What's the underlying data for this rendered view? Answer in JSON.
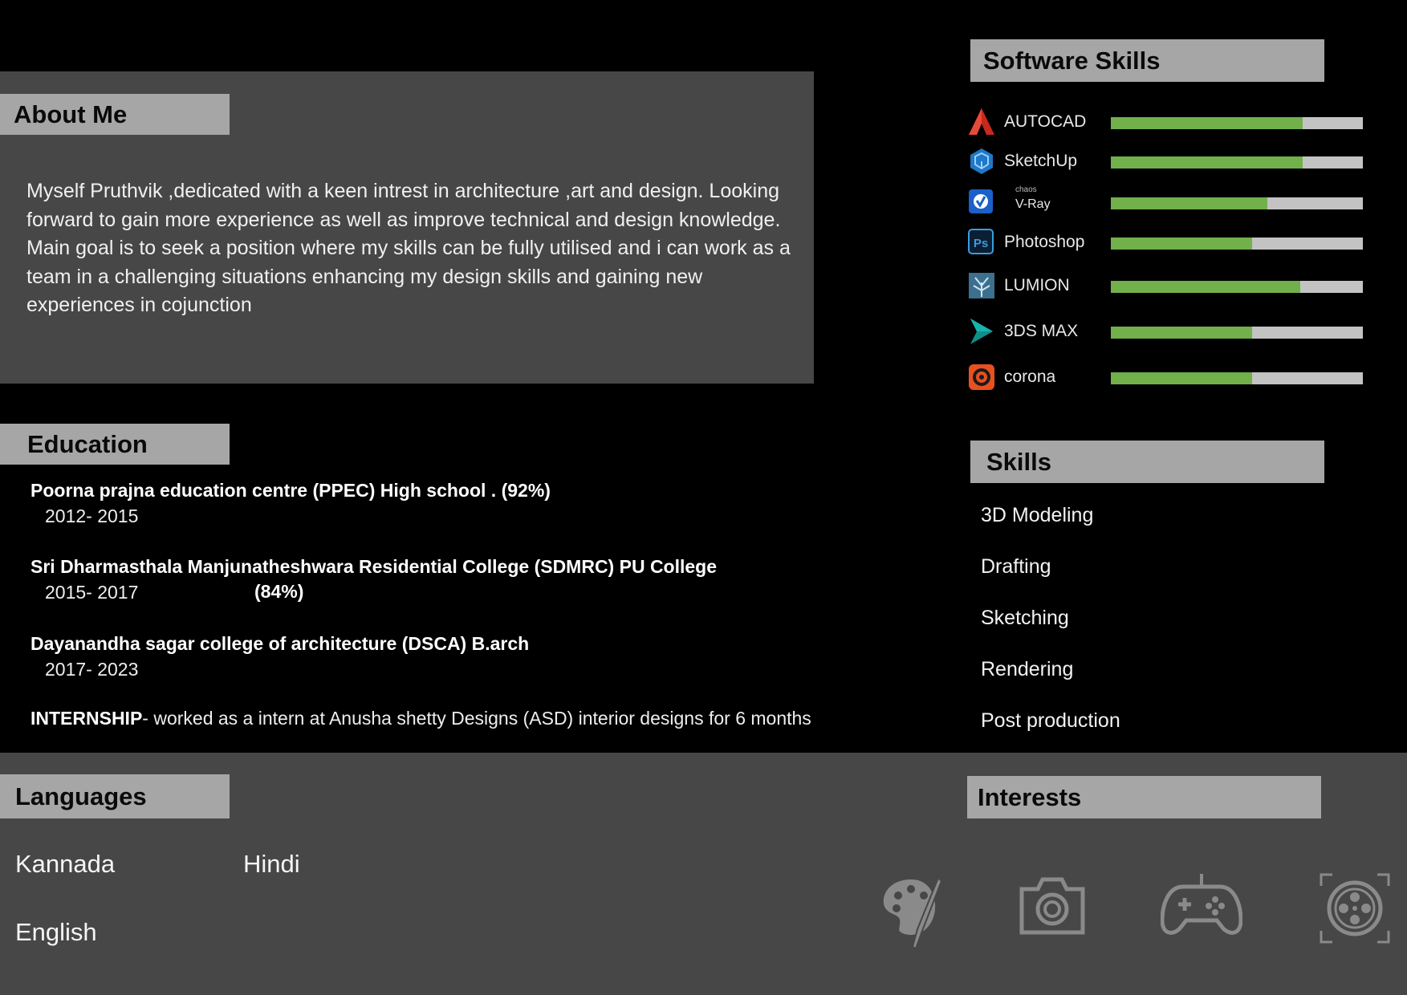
{
  "about": {
    "title": "About Me",
    "text": "Myself Pruthvik  ,dedicated with a keen intrest in architecture ,art and design. Looking forward to gain more experience as well as improve technical and design knowledge. Main goal is to seek a position where my skills can be fully utilised and i can work as a team in a challenging situations enhancing my design skills and gaining new experiences in cojunction"
  },
  "education": {
    "title": "Education",
    "items": [
      {
        "title": "Poorna prajna education centre (PPEC) High school . (92%)",
        "years": "2012- 2015"
      },
      {
        "title": "Sri Dharmasthala Manjunatheshwara Residential College (SDMRC) PU College",
        "years": "2015- 2017",
        "percent": "(84%)"
      },
      {
        "title": "Dayanandha sagar college of architecture (DSCA) B.arch",
        "years": "2017- 2023"
      }
    ],
    "internship_label": "INTERNSHIP",
    "internship_text": "-  worked as a intern at Anusha shetty Designs (ASD) interior designs  for 6 months"
  },
  "software_skills": {
    "title": "Software Skills",
    "items": [
      {
        "name": "AUTOCAD",
        "icon": "autocad-icon",
        "level": 0.76
      },
      {
        "name": "SketchUp",
        "icon": "sketchup-icon",
        "level": 0.76
      },
      {
        "name": "V-Ray",
        "brand": "chaos",
        "icon": "vray-icon",
        "level": 0.62
      },
      {
        "name": "Photoshop",
        "icon": "photoshop-icon",
        "level": 0.56
      },
      {
        "name": "LUMION",
        "icon": "lumion-icon",
        "level": 0.75
      },
      {
        "name": "3DS MAX",
        "icon": "3dsmax-icon",
        "level": 0.56
      },
      {
        "name": "corona",
        "icon": "corona-icon",
        "level": 0.56
      }
    ],
    "colors": {
      "fill": "#71b04a",
      "track": "#c3c3c3"
    }
  },
  "skills": {
    "title": "Skills",
    "items": [
      "3D Modeling",
      "Drafting",
      "Sketching",
      "Rendering",
      "Post production"
    ]
  },
  "languages": {
    "title": "Languages",
    "items": [
      "Kannada",
      "Hindi",
      "English"
    ]
  },
  "interests": {
    "title": "Interests",
    "icons": [
      "palette-icon",
      "camera-icon",
      "gamepad-icon",
      "film-reel-icon"
    ]
  }
}
